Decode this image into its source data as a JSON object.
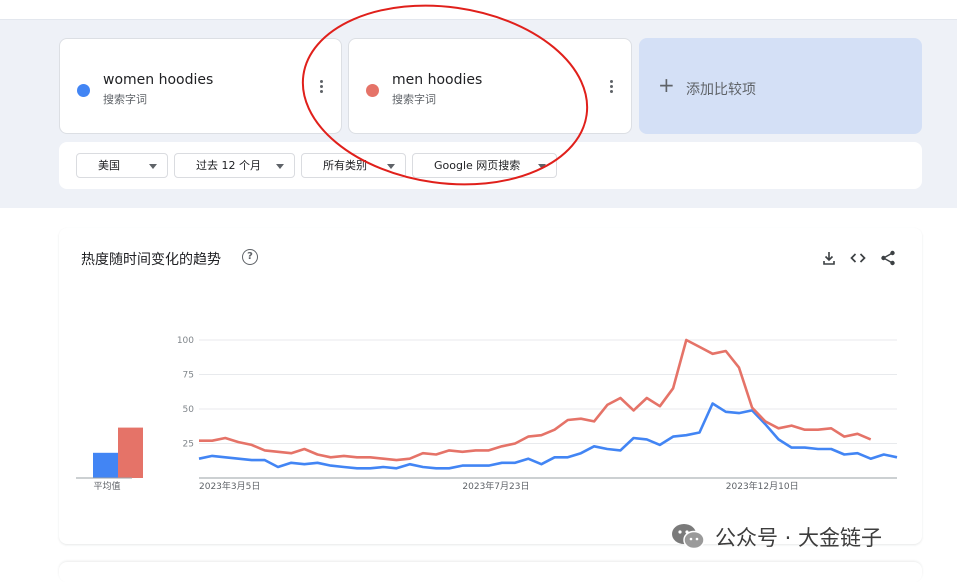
{
  "terms": [
    {
      "name": "women hoodies",
      "type": "搜索字词",
      "color": "#4285f4"
    },
    {
      "name": "men hoodies",
      "type": "搜索字词",
      "color": "#e57368"
    }
  ],
  "add_compare": {
    "label": "添加比较项"
  },
  "filters": {
    "region": "美国",
    "time": "过去 12 个月",
    "category": "所有类别",
    "property": "Google 网页搜索"
  },
  "chart_section": {
    "title": "热度随时间变化的趋势",
    "help_icon": "help-circle-icon",
    "actions": [
      "download-icon",
      "embed-code-icon",
      "share-icon"
    ]
  },
  "annotation": {
    "color": "#e0201b"
  },
  "watermark": {
    "icon": "wechat-icon",
    "text": "公众号 · 大金链子"
  },
  "chart_data": [
    {
      "type": "bar",
      "categories": [
        "平均值"
      ],
      "series": [
        {
          "name": "women hoodies",
          "values": [
            18
          ]
        },
        {
          "name": "men hoodies",
          "values": [
            36
          ]
        }
      ],
      "ylim": [
        0,
        100
      ]
    },
    {
      "type": "line",
      "xlabel": "",
      "ylabel": "",
      "ylim": [
        0,
        100
      ],
      "yticks": [
        25,
        50,
        75,
        100
      ],
      "xtick_labels": [
        {
          "label": "2023年3月5日",
          "index": 0
        },
        {
          "label": "2023年7月23日",
          "index": 20
        },
        {
          "label": "2023年12月10日",
          "index": 40
        }
      ],
      "grid": true,
      "series": [
        {
          "name": "women hoodies",
          "color": "#4285f4",
          "values": [
            14,
            16,
            15,
            14,
            13,
            13,
            8,
            11,
            10,
            11,
            9,
            8,
            7,
            7,
            8,
            7,
            10,
            8,
            7,
            7,
            9,
            9,
            9,
            11,
            11,
            14,
            10,
            15,
            15,
            18,
            23,
            21,
            20,
            29,
            28,
            24,
            30,
            31,
            33,
            54,
            48,
            47,
            49,
            39,
            28,
            22,
            22,
            21,
            21,
            17,
            18,
            14,
            17,
            15
          ]
        },
        {
          "name": "men hoodies",
          "color": "#e57368",
          "values": [
            27,
            27,
            29,
            26,
            24,
            20,
            19,
            18,
            21,
            17,
            15,
            16,
            15,
            15,
            14,
            13,
            14,
            18,
            17,
            20,
            19,
            20,
            20,
            23,
            25,
            30,
            31,
            35,
            42,
            43,
            41,
            53,
            58,
            49,
            58,
            52,
            65,
            100,
            95,
            90,
            92,
            80,
            51,
            41,
            36,
            38,
            35,
            35,
            36,
            30,
            32,
            28
          ]
        }
      ]
    }
  ]
}
